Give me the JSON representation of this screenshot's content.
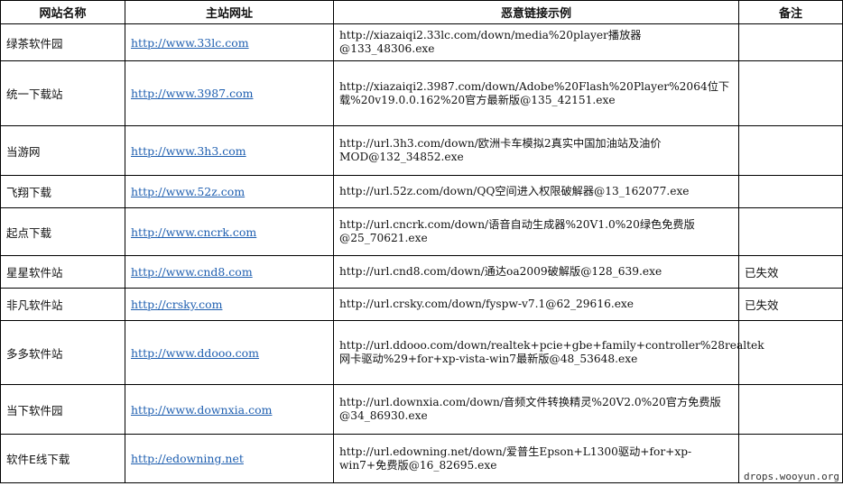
{
  "table": {
    "headers": [
      "网站名称",
      "主站网址",
      "恶意链接示例",
      "备注"
    ],
    "rows": [
      {
        "name": "绿茶软件园",
        "url": "http://www.33lc.com",
        "example": "http://xiazaiqi2.33lc.com/down/media%20player播放器@133_48306.exe",
        "note": ""
      },
      {
        "name": "统一下载站",
        "url": "http://www.3987.com",
        "example": "http://xiazaiqi2.3987.com/down/Adobe%20Flash%20Player%2064位下载%20v19.0.0.162%20官方最新版@135_42151.exe",
        "note": ""
      },
      {
        "name": "当游网",
        "url": "http://www.3h3.com",
        "example": "http://url.3h3.com/down/欧洲卡车模拟2真实中国加油站及油价MOD@132_34852.exe",
        "note": ""
      },
      {
        "name": "飞翔下载",
        "url": "http://www.52z.com",
        "example": "http://url.52z.com/down/QQ空间进入权限破解器@13_162077.exe",
        "note": ""
      },
      {
        "name": "起点下载",
        "url": "http://www.cncrk.com",
        "example": "http://url.cncrk.com/down/语音自动生成器%20V1.0%20绿色免费版@25_70621.exe",
        "note": ""
      },
      {
        "name": "星星软件站",
        "url": "http://www.cnd8.com",
        "example": "http://url.cnd8.com/down/通达oa2009破解版@128_639.exe",
        "note": "已失效"
      },
      {
        "name": "非凡软件站",
        "url": "http://crsky.com",
        "example": "http://url.crsky.com/down/fyspw-v7.1@62_29616.exe",
        "note": "已失效"
      },
      {
        "name": "多多软件站",
        "url": "http://www.ddooo.com",
        "example": "http://url.ddooo.com/down/realtek+pcie+gbe+family+controller%28realtek网卡驱动%29+for+xp-vista-win7最新版@48_53648.exe",
        "note": ""
      },
      {
        "name": "当下软件园",
        "url": "http://www.downxia.com",
        "example": "http://url.downxia.com/down/音频文件转换精灵%20V2.0%20官方免费版@34_86930.exe",
        "note": ""
      },
      {
        "name": "软件E线下载",
        "url": "http://edowning.net",
        "example": "http://url.edowning.net/down/爱普生Epson+L1300驱动+for+xp-win7+免费版@16_82695.exe",
        "note": ""
      }
    ]
  },
  "watermark": "drops.wooyun.org"
}
